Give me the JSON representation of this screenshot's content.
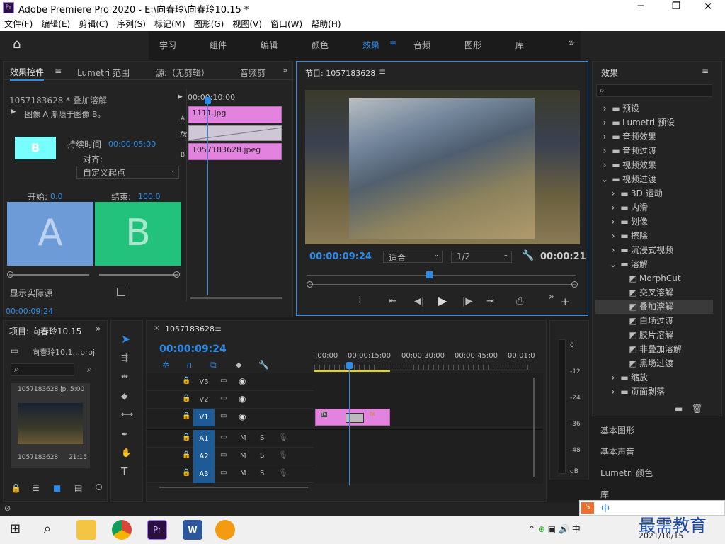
{
  "window": {
    "title": "Adobe Premiere Pro 2020 - E:\\向春玲\\向春玲10.15 *",
    "app_badge": "Pr"
  },
  "menu": [
    "文件(F)",
    "编辑(E)",
    "剪辑(C)",
    "序列(S)",
    "标记(M)",
    "图形(G)",
    "视图(V)",
    "窗口(W)",
    "帮助(H)"
  ],
  "workspaces": [
    "学习",
    "组件",
    "编辑",
    "颜色",
    "效果",
    "音频",
    "图形",
    "库"
  ],
  "workspaces_active": "效果",
  "effect_controls": {
    "tabs": [
      "效果控件",
      "Lumetri 范围",
      "源:（无剪辑）",
      "音频剪"
    ],
    "clip_label": "1057183628 * 叠加溶解",
    "time_ruler": "00:00:10:00",
    "description": "图像 A 渐隐于图像 B。",
    "duration_label": "持续时间",
    "duration_value": "00:00:05:00",
    "align_label": "对齐:",
    "align_value": "自定义起点",
    "start_label": "开始:",
    "start_value": "0.0",
    "end_label": "结束:",
    "end_value": "100.0",
    "a_letter": "A",
    "b_letter": "B",
    "thumb_letter": "B",
    "clip_a": "1111.jpg",
    "clip_b": "1057183628.jpeg",
    "row_a": "A",
    "row_fx": "fx",
    "row_b": "B",
    "show_source": "显示实际源",
    "current_time": "00:00:09:24"
  },
  "program": {
    "title": "节目: 1057183628",
    "timecode": "00:00:09:24",
    "fit": "适合",
    "resolution": "1/2",
    "duration": "00:00:21"
  },
  "effects": {
    "title": "效果",
    "tree": [
      {
        "label": "预设",
        "level": 0,
        "type": "bin"
      },
      {
        "label": "Lumetri 预设",
        "level": 0,
        "type": "bin"
      },
      {
        "label": "音频效果",
        "level": 0,
        "type": "folder"
      },
      {
        "label": "音频过渡",
        "level": 0,
        "type": "folder"
      },
      {
        "label": "视频效果",
        "level": 0,
        "type": "folder"
      },
      {
        "label": "视频过渡",
        "level": 0,
        "type": "folder",
        "open": true
      },
      {
        "label": "3D 运动",
        "level": 1,
        "type": "folder"
      },
      {
        "label": "内滑",
        "level": 1,
        "type": "folder"
      },
      {
        "label": "划像",
        "level": 1,
        "type": "folder"
      },
      {
        "label": "擦除",
        "level": 1,
        "type": "folder"
      },
      {
        "label": "沉浸式视频",
        "level": 1,
        "type": "folder"
      },
      {
        "label": "溶解",
        "level": 1,
        "type": "folder",
        "open": true
      },
      {
        "label": "MorphCut",
        "level": 2,
        "type": "fx"
      },
      {
        "label": "交叉溶解",
        "level": 2,
        "type": "fx"
      },
      {
        "label": "叠加溶解",
        "level": 2,
        "type": "fx",
        "selected": true
      },
      {
        "label": "白场过渡",
        "level": 2,
        "type": "fx"
      },
      {
        "label": "胶片溶解",
        "level": 2,
        "type": "fx"
      },
      {
        "label": "非叠加溶解",
        "level": 2,
        "type": "fx"
      },
      {
        "label": "黑场过渡",
        "level": 2,
        "type": "fx"
      },
      {
        "label": "缩放",
        "level": 1,
        "type": "folder"
      },
      {
        "label": "页面剥落",
        "level": 1,
        "type": "folder"
      }
    ],
    "extra_panels": [
      "基本图形",
      "基本声音",
      "Lumetri 颜色",
      "库"
    ]
  },
  "project": {
    "title": "项目: 向春玲10.15",
    "file": "向春玲10.1...proj",
    "item_name": "1057183628.jp...",
    "item_dur": "5:00",
    "item_label": "1057183628",
    "item_dur2": "21:15"
  },
  "timeline": {
    "seq": "1057183628",
    "timecode": "00:00:09:24",
    "ruler": [
      ":00:00",
      "00:00:15:00",
      "00:00:30:00",
      "00:00:45:00",
      "00:01:0"
    ],
    "video_tracks": [
      "V3",
      "V2",
      "V1"
    ],
    "audio_tracks": [
      "A1",
      "A2",
      "A3"
    ],
    "m_label": "M",
    "s_label": "S"
  },
  "meter": {
    "labels": [
      "0",
      "-12",
      "-24",
      "-36",
      "-48",
      "dB"
    ]
  },
  "taskbar": {
    "time": "",
    "date": "2021/10/15",
    "watermark": "最需教育",
    "ime": "中",
    "ime2": "中"
  }
}
